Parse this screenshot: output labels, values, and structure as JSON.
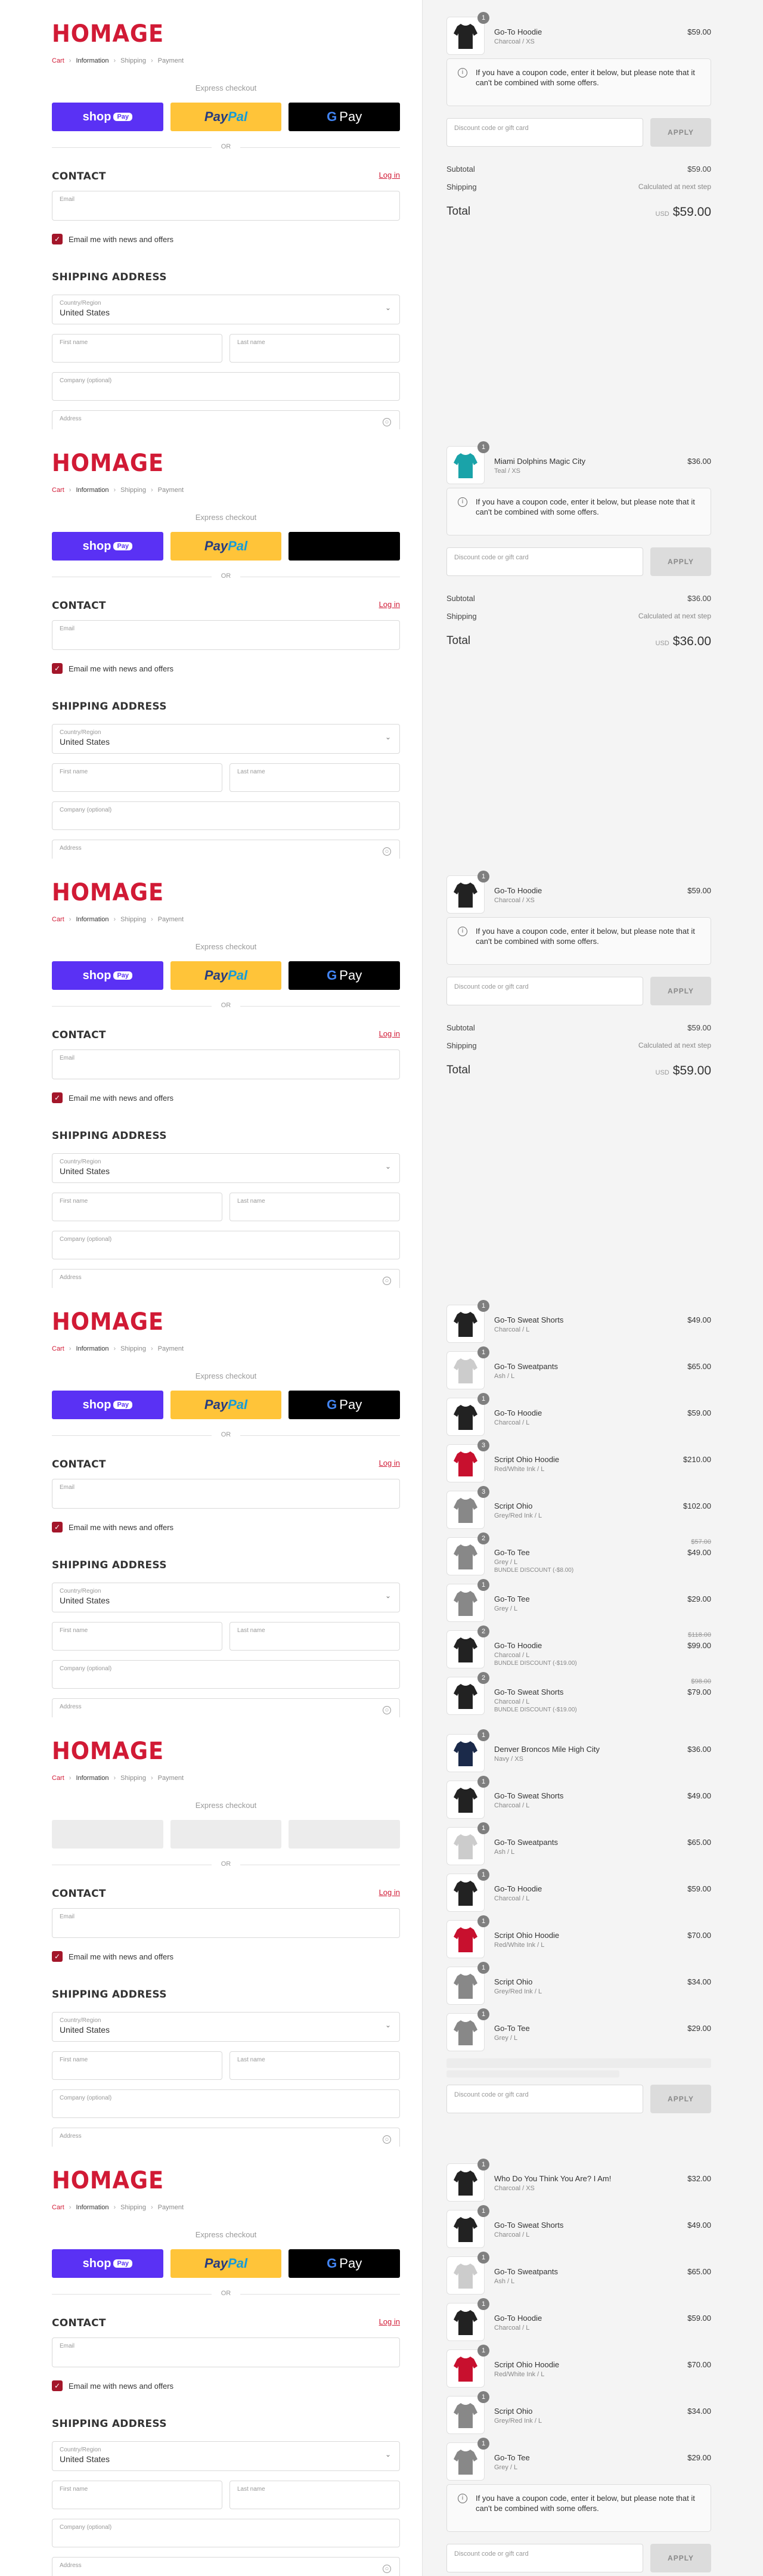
{
  "brand": "HOMAGE",
  "breadcrumb": [
    "Cart",
    "Information",
    "Shipping",
    "Payment"
  ],
  "express_title": "Express checkout",
  "or_text": "OR",
  "pay": {
    "shop": "shop",
    "shop_pill": "Pay",
    "paypal_a": "Pay",
    "paypal_b": "Pal",
    "gpay_g": "G",
    "gpay_text": "Pay"
  },
  "contact": {
    "title": "CONTACT",
    "login": "Log in",
    "email_placeholder": "Email",
    "news": "Email me with news and offers"
  },
  "shipping": {
    "title": "SHIPPING ADDRESS",
    "country_label": "Country/Region",
    "country": "United States",
    "first": "First name",
    "last": "Last name",
    "company": "Company (optional)",
    "address": "Address"
  },
  "discount_placeholder": "Discount code or gift card",
  "apply": "APPLY",
  "coupon_notice": "If you have a coupon code, enter it below, but please note that it can't be combined with some offers.",
  "subtotal_label": "Subtotal",
  "shipping_label": "Shipping",
  "shipping_value": "Calculated at next step",
  "total_label": "Total",
  "currency": "USD",
  "frames": [
    {
      "items": [
        {
          "name": "Go-To Hoodie",
          "variant": "Charcoal / XS",
          "price": "$59.00",
          "qty": "1",
          "color": "#222"
        }
      ],
      "subtotal": "$59.00",
      "total": "$59.00"
    },
    {
      "items": [
        {
          "name": "Miami Dolphins Magic City",
          "variant": "Teal / XS",
          "price": "$36.00",
          "qty": "1",
          "color": "#1aa3a9"
        }
      ],
      "subtotal": "$36.00",
      "total": "$36.00"
    },
    {
      "items": [
        {
          "name": "Go-To Hoodie",
          "variant": "Charcoal / XS",
          "price": "$59.00",
          "qty": "1",
          "color": "#222"
        }
      ],
      "subtotal": "$59.00",
      "total": "$59.00"
    },
    {
      "items": [
        {
          "name": "Go-To Sweat Shorts",
          "variant": "Charcoal / L",
          "price": "$49.00",
          "qty": "1",
          "color": "#222"
        },
        {
          "name": "Go-To Sweatpants",
          "variant": "Ash / L",
          "price": "$65.00",
          "qty": "1",
          "color": "#ccc"
        },
        {
          "name": "Go-To Hoodie",
          "variant": "Charcoal / L",
          "price": "$59.00",
          "qty": "1",
          "color": "#222"
        },
        {
          "name": "Script Ohio Hoodie",
          "variant": "Red/White Ink / L",
          "price": "$210.00",
          "qty": "3",
          "color": "#c8102e"
        },
        {
          "name": "Script Ohio",
          "variant": "Grey/Red Ink / L",
          "price": "$102.00",
          "qty": "3",
          "color": "#888"
        },
        {
          "name": "Go-To Tee",
          "variant": "Grey / L",
          "price": "$49.00",
          "old": "$57.00",
          "discount": "BUNDLE DISCOUNT (-$8.00)",
          "qty": "2",
          "color": "#888"
        },
        {
          "name": "Go-To Tee",
          "variant": "Grey / L",
          "price": "$29.00",
          "qty": "1",
          "color": "#888"
        },
        {
          "name": "Go-To Hoodie",
          "variant": "Charcoal / L",
          "price": "$99.00",
          "old": "$118.00",
          "discount": "BUNDLE DISCOUNT (-$19.00)",
          "qty": "2",
          "color": "#222"
        },
        {
          "name": "Go-To Sweat Shorts",
          "variant": "Charcoal / L",
          "price": "$79.00",
          "old": "$98.00",
          "discount": "BUNDLE DISCOUNT (-$19.00)",
          "qty": "2",
          "color": "#222"
        }
      ]
    },
    {
      "items": [
        {
          "name": "Denver Broncos Mile High City",
          "variant": "Navy / XS",
          "price": "$36.00",
          "qty": "1",
          "color": "#1b2a4a"
        },
        {
          "name": "Go-To Sweat Shorts",
          "variant": "Charcoal / L",
          "price": "$49.00",
          "qty": "1",
          "color": "#222"
        },
        {
          "name": "Go-To Sweatpants",
          "variant": "Ash / L",
          "price": "$65.00",
          "qty": "1",
          "color": "#ccc"
        },
        {
          "name": "Go-To Hoodie",
          "variant": "Charcoal / L",
          "price": "$59.00",
          "qty": "1",
          "color": "#222"
        },
        {
          "name": "Script Ohio Hoodie",
          "variant": "Red/White Ink / L",
          "price": "$70.00",
          "qty": "1",
          "color": "#c8102e"
        },
        {
          "name": "Script Ohio",
          "variant": "Grey/Red Ink / L",
          "price": "$34.00",
          "qty": "1",
          "color": "#888"
        },
        {
          "name": "Go-To Tee",
          "variant": "Grey / L",
          "price": "$29.00",
          "qty": "1",
          "color": "#888"
        }
      ]
    },
    {
      "items": [
        {
          "name": "Who Do You Think You Are? I Am!",
          "variant": "Charcoal / XS",
          "price": "$32.00",
          "qty": "1",
          "color": "#222"
        },
        {
          "name": "Go-To Sweat Shorts",
          "variant": "Charcoal / L",
          "price": "$49.00",
          "qty": "1",
          "color": "#222"
        },
        {
          "name": "Go-To Sweatpants",
          "variant": "Ash / L",
          "price": "$65.00",
          "qty": "1",
          "color": "#ccc"
        },
        {
          "name": "Go-To Hoodie",
          "variant": "Charcoal / L",
          "price": "$59.00",
          "qty": "1",
          "color": "#222"
        },
        {
          "name": "Script Ohio Hoodie",
          "variant": "Red/White Ink / L",
          "price": "$70.00",
          "qty": "1",
          "color": "#c8102e"
        },
        {
          "name": "Script Ohio",
          "variant": "Grey/Red Ink / L",
          "price": "$34.00",
          "qty": "1",
          "color": "#888"
        },
        {
          "name": "Go-To Tee",
          "variant": "Grey / L",
          "price": "$29.00",
          "qty": "1",
          "color": "#888"
        }
      ]
    }
  ]
}
